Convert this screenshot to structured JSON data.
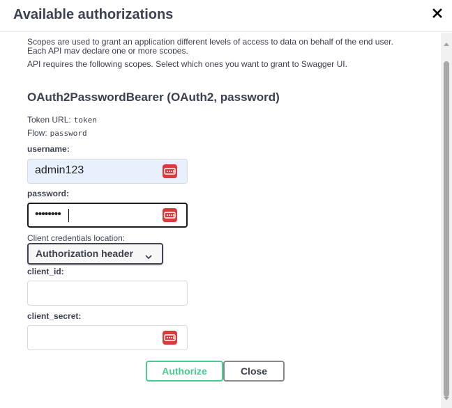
{
  "modal": {
    "title": "Available authorizations",
    "close_icon": "close-icon"
  },
  "description": {
    "line1": "Scopes are used to grant an application different levels of access to data on behalf of the end user.",
    "line2": "Each API may declare one or more scopes.",
    "line3": "API requires the following scopes. Select which ones you want to grant to Swagger UI."
  },
  "scheme": {
    "title": "OAuth2PasswordBearer (OAuth2, password)",
    "token_url_label": "Token URL:",
    "token_url_value": "token",
    "flow_label": "Flow:",
    "flow_value": "password"
  },
  "form": {
    "username_label": "username:",
    "username_value": "admin123",
    "password_label": "password:",
    "password_value": "••••••••",
    "client_location_label": "Client credentials location:",
    "client_location_value": "Authorization header",
    "client_id_label": "client_id:",
    "client_id_value": "",
    "client_secret_label": "client_secret:",
    "client_secret_value": ""
  },
  "buttons": {
    "authorize": "Authorize",
    "close": "Close"
  },
  "colors": {
    "authorize": "#49cc90",
    "password_manager_icon": "#d93b3b",
    "autofill_bg": "#e8f0fe"
  },
  "icons": {
    "password_manager": "password-manager-icon",
    "dropdown": "chevron-down-icon"
  }
}
